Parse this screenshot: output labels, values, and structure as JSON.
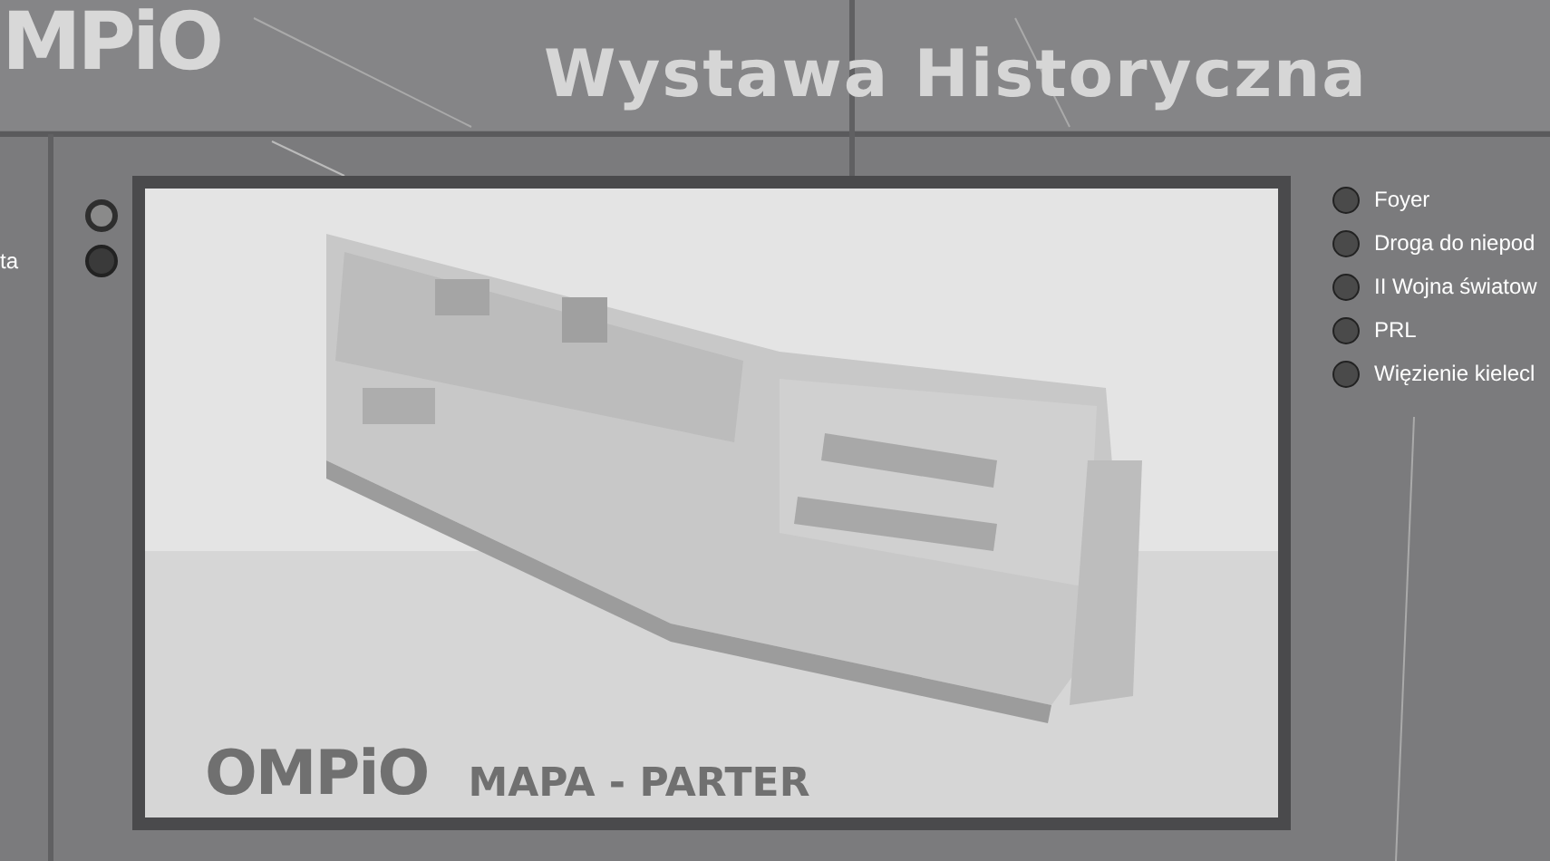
{
  "header": {
    "logo": "MPiO",
    "title_line_2": "Wystawa Historyczna"
  },
  "left_menu": {
    "cut_label": "ta",
    "buttons": [
      {
        "selected": true
      },
      {
        "selected": false
      }
    ]
  },
  "map": {
    "caption_logo": "OMPiO",
    "caption": "MAPA - PARTER"
  },
  "right_menu": [
    {
      "label": "Foyer"
    },
    {
      "label": "Droga do niepod"
    },
    {
      "label": "II Wojna światow"
    },
    {
      "label": "PRL"
    },
    {
      "label": "Więzienie kielecl"
    }
  ]
}
